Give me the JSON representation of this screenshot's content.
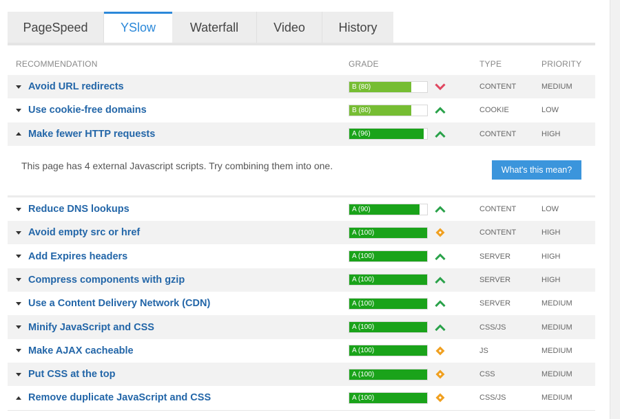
{
  "tabs": [
    {
      "label": "PageSpeed",
      "active": false
    },
    {
      "label": "YSlow",
      "active": true
    },
    {
      "label": "Waterfall",
      "active": false
    },
    {
      "label": "Video",
      "active": false
    },
    {
      "label": "History",
      "active": false
    }
  ],
  "table": {
    "headers": {
      "recommendation": "RECOMMENDATION",
      "grade": "GRADE",
      "type": "TYPE",
      "priority": "PRIORITY"
    },
    "rows": [
      {
        "name": "Avoid URL redirects",
        "grade": "B (80)",
        "score": 80,
        "trend": "down",
        "type": "CONTENT",
        "priority": "MEDIUM",
        "expanded": false
      },
      {
        "name": "Use cookie-free domains",
        "grade": "B (80)",
        "score": 80,
        "trend": "up",
        "type": "COOKIE",
        "priority": "LOW",
        "expanded": false
      },
      {
        "name": "Make fewer HTTP requests",
        "grade": "A (96)",
        "score": 96,
        "trend": "up",
        "type": "CONTENT",
        "priority": "HIGH",
        "expanded": true
      },
      {
        "name": "Reduce DNS lookups",
        "grade": "A (90)",
        "score": 90,
        "trend": "up",
        "type": "CONTENT",
        "priority": "LOW",
        "expanded": false
      },
      {
        "name": "Avoid empty src or href",
        "grade": "A (100)",
        "score": 100,
        "trend": "same",
        "type": "CONTENT",
        "priority": "HIGH",
        "expanded": false
      },
      {
        "name": "Add Expires headers",
        "grade": "A (100)",
        "score": 100,
        "trend": "up",
        "type": "SERVER",
        "priority": "HIGH",
        "expanded": false
      },
      {
        "name": "Compress components with gzip",
        "grade": "A (100)",
        "score": 100,
        "trend": "up",
        "type": "SERVER",
        "priority": "HIGH",
        "expanded": false
      },
      {
        "name": "Use a Content Delivery Network (CDN)",
        "grade": "A (100)",
        "score": 100,
        "trend": "up",
        "type": "SERVER",
        "priority": "MEDIUM",
        "expanded": false
      },
      {
        "name": "Minify JavaScript and CSS",
        "grade": "A (100)",
        "score": 100,
        "trend": "up",
        "type": "CSS/JS",
        "priority": "MEDIUM",
        "expanded": false
      },
      {
        "name": "Make AJAX cacheable",
        "grade": "A (100)",
        "score": 100,
        "trend": "same",
        "type": "JS",
        "priority": "MEDIUM",
        "expanded": false
      },
      {
        "name": "Put CSS at the top",
        "grade": "A (100)",
        "score": 100,
        "trend": "same",
        "type": "CSS",
        "priority": "MEDIUM",
        "expanded": false
      },
      {
        "name": "Remove duplicate JavaScript and CSS",
        "grade": "A (100)",
        "score": 100,
        "trend": "same",
        "type": "CSS/JS",
        "priority": "MEDIUM",
        "expanded": true
      }
    ]
  },
  "detail": {
    "text": "This page has 4 external Javascript scripts. Try combining them into one.",
    "button_label": "What's this mean?"
  },
  "colors": {
    "grade_a": "#1aa31a",
    "grade_b": "#76bd33",
    "trend_up": "#2aa24a",
    "trend_down": "#e0465f",
    "trend_same": "#f0a020",
    "link": "#2366a8",
    "accent": "#2b88d9"
  }
}
